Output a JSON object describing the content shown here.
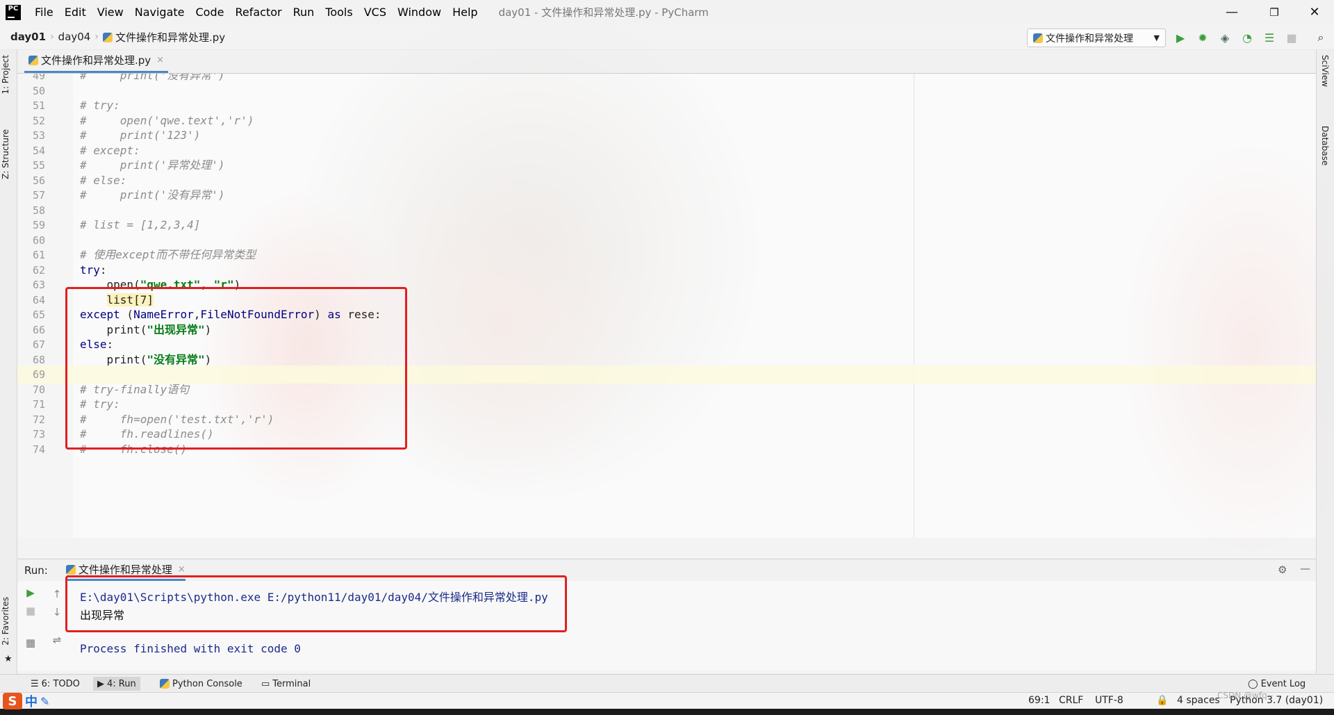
{
  "window": {
    "title": "day01 - 文件操作和异常处理.py - PyCharm",
    "app_icon_text": "PC",
    "minimize": "—",
    "restore": "❐",
    "close": "✕"
  },
  "menu": [
    "File",
    "Edit",
    "View",
    "Navigate",
    "Code",
    "Refactor",
    "Run",
    "Tools",
    "VCS",
    "Window",
    "Help"
  ],
  "breadcrumb": {
    "project": "day01",
    "folder": "day04",
    "file": "文件操作和异常处理.py"
  },
  "run_config": {
    "label": "文件操作和异常处理",
    "dropdown": "▼"
  },
  "toolbar_icons": [
    "run-icon",
    "debug-icon",
    "coverage-icon",
    "profile-icon",
    "concurrency-icon",
    "stop-icon",
    "search-icon"
  ],
  "left_tool_tabs": {
    "project": "1: Project",
    "structure": "Z: Structure",
    "favorites": "2: Favorites"
  },
  "right_tool_tabs": {
    "sciview": "SciView",
    "database": "Database"
  },
  "editor_tab": {
    "label": "文件操作和异常处理.py",
    "close": "×"
  },
  "editor": {
    "lines": [
      {
        "n": "49",
        "text": "#     print('没有异常')",
        "kind": "comment"
      },
      {
        "n": "50",
        "text": "",
        "kind": "plain"
      },
      {
        "n": "51",
        "text": "# try:",
        "kind": "comment"
      },
      {
        "n": "52",
        "text": "#     open('qwe.text','r')",
        "kind": "comment"
      },
      {
        "n": "53",
        "text": "#     print('123')",
        "kind": "comment"
      },
      {
        "n": "54",
        "text": "# except:",
        "kind": "comment"
      },
      {
        "n": "55",
        "text": "#     print('异常处理')",
        "kind": "comment"
      },
      {
        "n": "56",
        "text": "# else:",
        "kind": "comment"
      },
      {
        "n": "57",
        "text": "#     print('没有异常')",
        "kind": "comment"
      },
      {
        "n": "58",
        "text": "",
        "kind": "plain"
      },
      {
        "n": "59",
        "text": "# list = [1,2,3,4]",
        "kind": "comment"
      },
      {
        "n": "60",
        "text": "",
        "kind": "plain"
      },
      {
        "n": "61",
        "text": "# 使用except而不带任何异常类型",
        "kind": "comment"
      },
      {
        "n": "62",
        "text": "try:",
        "kind": "keyword"
      },
      {
        "n": "63",
        "text": "    open(\"qwe.txt\", \"r\")",
        "kind": "call_open"
      },
      {
        "n": "64",
        "text": "    list[7]",
        "kind": "highlight"
      },
      {
        "n": "65",
        "text": "except (NameError,FileNotFoundError) as rese:",
        "kind": "except"
      },
      {
        "n": "66",
        "text": "    print(\"出现异常\")",
        "kind": "print1"
      },
      {
        "n": "67",
        "text": "else:",
        "kind": "keyword"
      },
      {
        "n": "68",
        "text": "    print(\"没有异常\")",
        "kind": "print2"
      },
      {
        "n": "69",
        "text": "",
        "kind": "current"
      },
      {
        "n": "70",
        "text": "# try-finally语句",
        "kind": "comment"
      },
      {
        "n": "71",
        "text": "# try:",
        "kind": "comment"
      },
      {
        "n": "72",
        "text": "#     fh=open('test.txt','r')",
        "kind": "comment"
      },
      {
        "n": "73",
        "text": "#     fh.readlines()",
        "kind": "comment"
      },
      {
        "n": "74",
        "text": "#     fh.close()",
        "kind": "comment"
      }
    ]
  },
  "run_panel": {
    "label": "Run:",
    "tab": "文件操作和异常处理",
    "tab_close": "×",
    "output": [
      "E:\\day01\\Scripts\\python.exe E:/python11/day01/day04/文件操作和异常处理.py",
      "出现异常",
      "",
      "Process finished with exit code 0"
    ]
  },
  "bottom_tabs": {
    "todo": "6: TODO",
    "run": "4: Run",
    "python_console": "Python Console",
    "terminal": "Terminal",
    "event_log": "Event Log"
  },
  "status": {
    "position": "69:1",
    "line_sep": "CRLF",
    "encoding": "UTF-8",
    "indent": "4 spaces",
    "interpreter": "Python 3.7 (day01)",
    "watermark": "CSDN @wfq--"
  },
  "ime": {
    "s": "S",
    "mode": "中"
  },
  "colors": {
    "annotation_red": "#e02020",
    "run_green": "#3d9e3d",
    "keyword_blue": "#000080",
    "string_green": "#067d17"
  }
}
